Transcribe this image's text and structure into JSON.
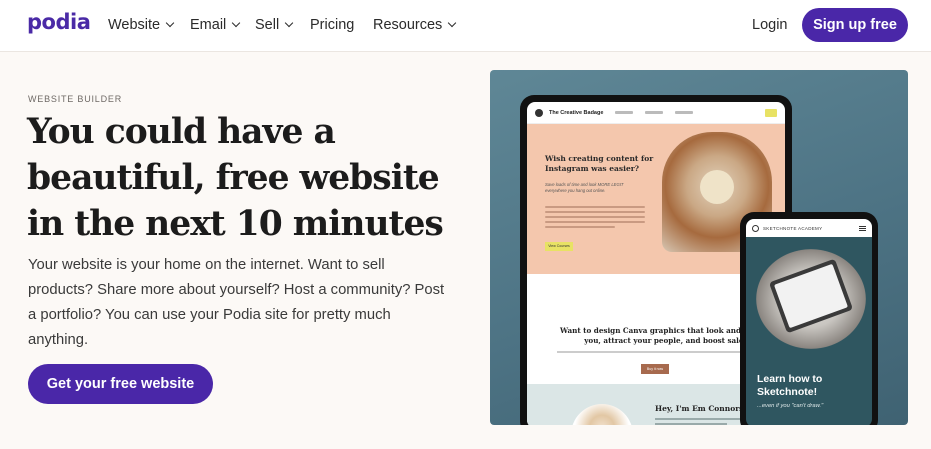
{
  "nav": {
    "logo": "podia",
    "items": [
      {
        "label": "Website",
        "dropdown": true
      },
      {
        "label": "Email",
        "dropdown": true
      },
      {
        "label": "Sell",
        "dropdown": true
      },
      {
        "label": "Pricing",
        "dropdown": false
      },
      {
        "label": "Resources",
        "dropdown": true
      }
    ],
    "login": "Login",
    "signup": "Sign up free"
  },
  "hero": {
    "eyebrow": "WEBSITE BUILDER",
    "headline": "You could have a beautiful, free website in the next 10 minutes",
    "lede": "Your website is your home on the internet. Want to sell products? Share more about yourself? Host a community? Post a portfolio? You can use your Podia site for pretty much anything.",
    "cta": "Get your free website"
  },
  "preview": {
    "tablet": {
      "brand": "The Creative Badage",
      "hero_title": "Wish creating content for Instagram was easier?",
      "hero_sub": "Save loads of time and look MORE LEGIT everywhere you hang out online.",
      "hero_button": "View Courses",
      "mid_title": "Want to design Canva graphics that look and feel like you, attract your people, and boost sales?",
      "mid_button": "Buy it now",
      "bottom_title": "Hey, I'm Em Connors"
    },
    "phone": {
      "brand": "SKETCHNOTE ACADEMY",
      "title": "Learn how to Sketchnote!",
      "subtitle": "...even if you \"can't draw.\""
    }
  },
  "colors": {
    "brand": "#4a27a8",
    "background": "#fcf9f6",
    "preview_bg": "#5f8796"
  }
}
